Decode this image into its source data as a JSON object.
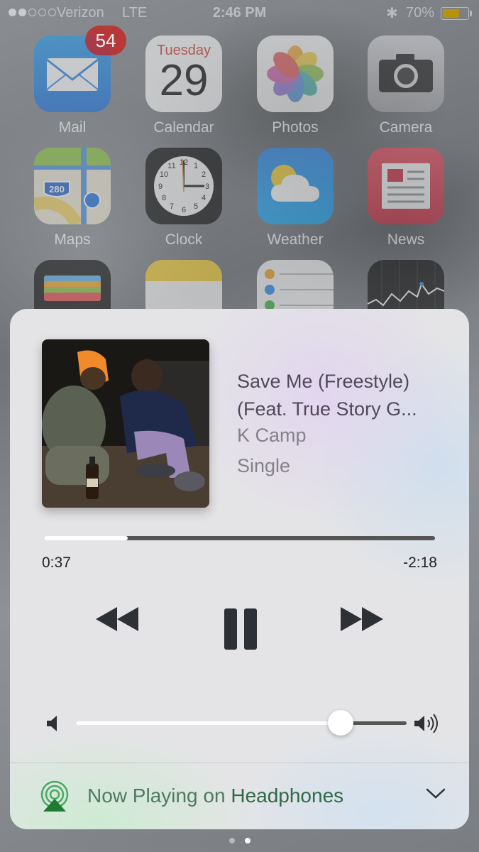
{
  "status_bar": {
    "carrier": "Verizon",
    "network": "LTE",
    "time": "2:46 PM",
    "battery_percent": "70%",
    "battery_level": 0.7,
    "signal_bars_filled": 2,
    "battery_color": "#b89208"
  },
  "home_screen": {
    "apps": [
      {
        "name": "Mail",
        "icon": "mail-icon",
        "badge": "54"
      },
      {
        "name": "Calendar",
        "icon": "calendar-icon",
        "day_name": "Tuesday",
        "day_number": "29"
      },
      {
        "name": "Photos",
        "icon": "photos-icon"
      },
      {
        "name": "Camera",
        "icon": "camera-icon"
      },
      {
        "name": "Maps",
        "icon": "maps-icon",
        "sign_number": "280"
      },
      {
        "name": "Clock",
        "icon": "clock-icon"
      },
      {
        "name": "Weather",
        "icon": "weather-icon"
      },
      {
        "name": "News",
        "icon": "news-icon"
      },
      {
        "name": "",
        "icon": "wallet-icon"
      },
      {
        "name": "",
        "icon": "notes-icon"
      },
      {
        "name": "",
        "icon": "reminders-icon"
      },
      {
        "name": "",
        "icon": "stocks-icon"
      }
    ]
  },
  "now_playing": {
    "song_line1": "Save Me (Freestyle)",
    "song_line2": "(Feat. True Story G...",
    "artist": "K Camp",
    "album": "Single",
    "elapsed": "0:37",
    "remaining": "-2:18",
    "progress": 0.215,
    "volume": 0.8,
    "output_prefix": "Now Playing on",
    "output_device": "Headphones",
    "accent_color": "#2e6a46"
  },
  "page_indicator": {
    "count": 2,
    "active_index": 1
  }
}
